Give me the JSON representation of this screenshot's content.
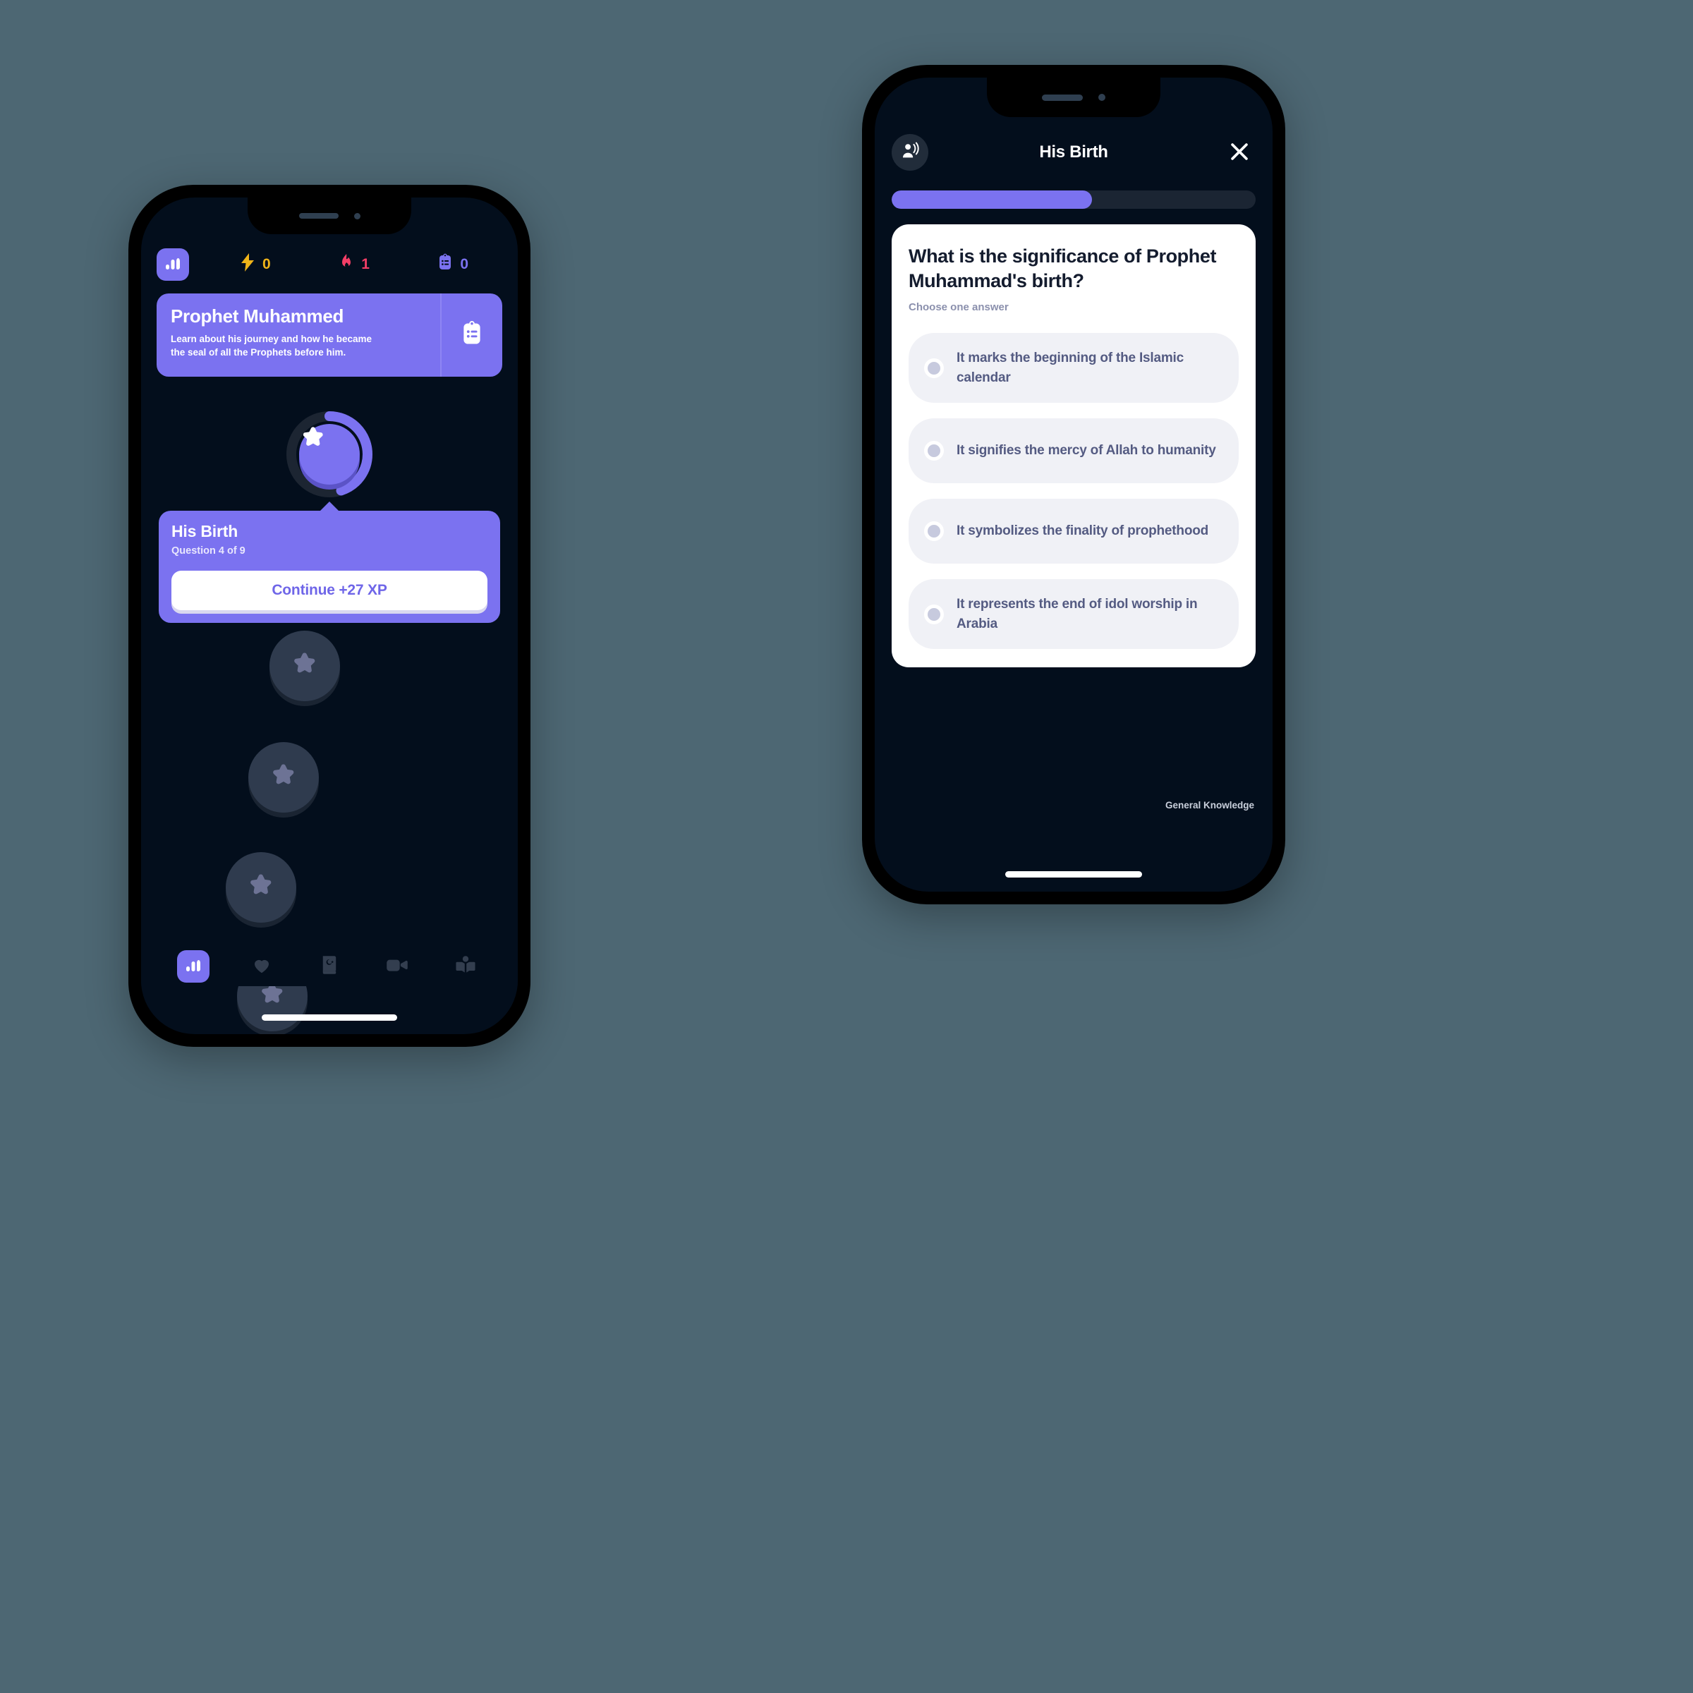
{
  "theme": {
    "page_background": "#4d6773",
    "screen_background": "#030e1c",
    "accent_purple": "#7b72f0",
    "xp_yellow": "#f0b419",
    "streak_red": "#f33e66",
    "card_white": "#ffffff",
    "option_grey": "#f0f1f6"
  },
  "left_phone": {
    "status": {
      "logo_icon": "bar-chart-icon",
      "xp": {
        "icon": "lightning-bolt-icon",
        "value": "0"
      },
      "streak": {
        "icon": "flame-icon",
        "value": "1"
      },
      "quizzes": {
        "icon": "clipboard-list-icon",
        "value": "0"
      }
    },
    "lesson_card": {
      "title": "Prophet Muhammed",
      "subtitle": "Learn about his journey and how he became the seal of all the Prophets before him.",
      "side_icon": "clipboard-list-icon"
    },
    "current_node": {
      "icon": "star-icon",
      "progress_percent": 45
    },
    "callout": {
      "title": "His Birth",
      "subtitle": "Question 4 of 9",
      "button_label": "Continue +27 XP"
    },
    "path_nodes": [
      {
        "icon": "star-icon",
        "state": "locked"
      },
      {
        "icon": "star-icon",
        "state": "locked"
      },
      {
        "icon": "star-icon",
        "state": "locked"
      },
      {
        "icon": "star-icon",
        "state": "locked"
      }
    ],
    "tabs": [
      {
        "name": "progress",
        "icon": "bar-chart-icon",
        "active": true
      },
      {
        "name": "favorites",
        "icon": "heart-icon",
        "active": false
      },
      {
        "name": "quran",
        "icon": "quran-book-icon",
        "active": false
      },
      {
        "name": "videos",
        "icon": "video-camera-icon",
        "active": false
      },
      {
        "name": "reading",
        "icon": "person-reading-book-icon",
        "active": false
      }
    ]
  },
  "right_phone": {
    "header": {
      "avatar_icon": "person-speaking-icon",
      "title": "His Birth",
      "close_icon": "close-icon"
    },
    "progress": {
      "percent": 55
    },
    "quiz": {
      "question": "What is the significance of Prophet Muhammad's birth?",
      "hint": "Choose one answer",
      "options": [
        {
          "label": "It marks the beginning of the Islamic calendar",
          "selected": false
        },
        {
          "label": "It signifies the mercy of Allah to humanity",
          "selected": false
        },
        {
          "label": "It symbolizes the finality of prophethood",
          "selected": false
        },
        {
          "label": "It represents the end of idol worship in Arabia",
          "selected": false
        }
      ]
    },
    "category": "General Knowledge"
  }
}
